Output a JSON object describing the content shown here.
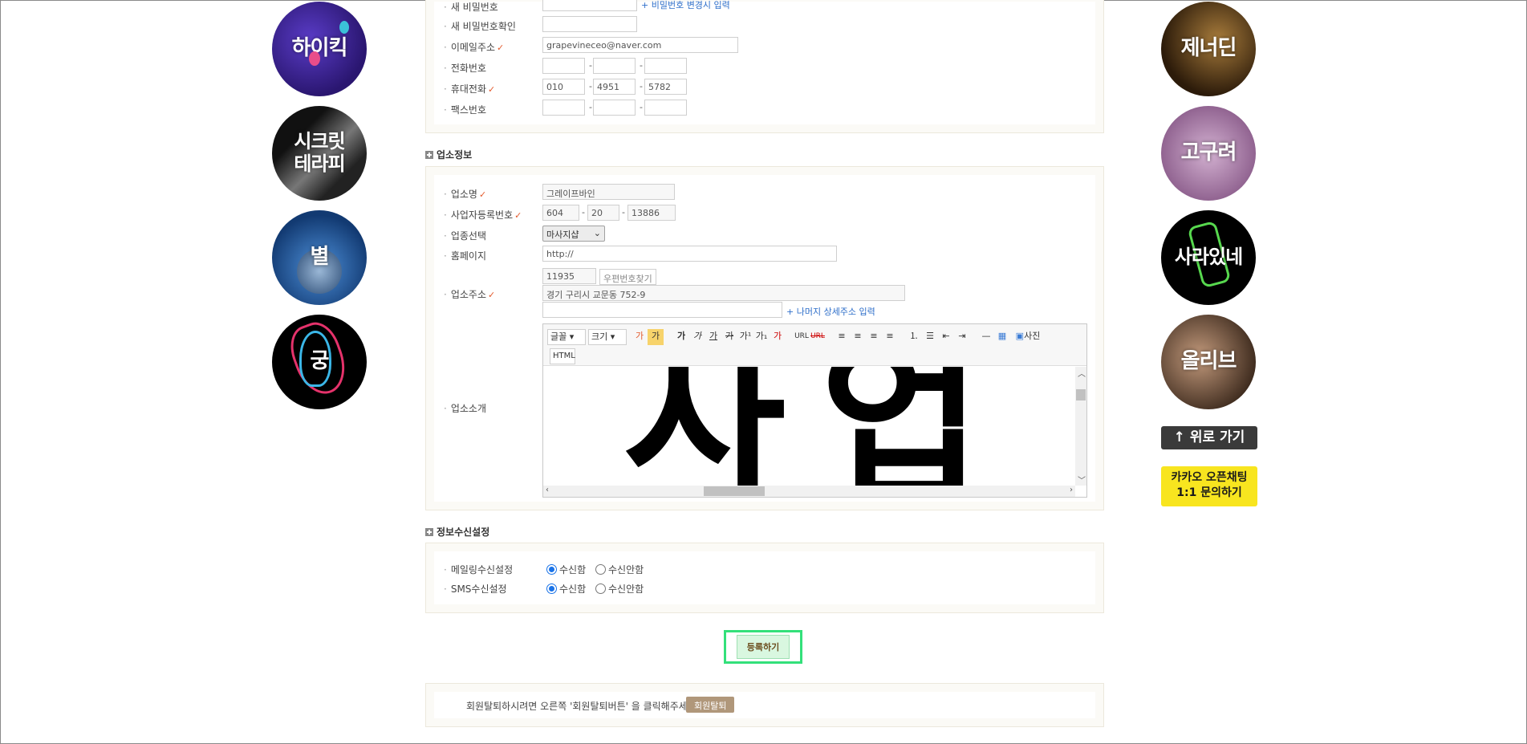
{
  "left_banners": [
    "하이킥",
    "시크릿 테라피",
    "별",
    "궁"
  ],
  "right_banners": [
    "제너딘",
    "고구려",
    "사라있네",
    "올리브"
  ],
  "top_button": "↑ 위로 가기",
  "kakao_button": {
    "line1": "카카오 오픈채팅",
    "line2": "1:1 문의하기"
  },
  "account": {
    "current_password_label": "새 비밀번호",
    "change_password_link": "+ 비밀번호 변경시 입력",
    "confirm_password_label": "새 비밀번호확인",
    "email_label": "이메일주소",
    "email_value": "grapevineceo@naver.com",
    "phone_label": "전화번호",
    "mobile_label": "휴대전화",
    "mobile": [
      "010",
      "4951",
      "5782"
    ],
    "fax_label": "팩스번호"
  },
  "business": {
    "section_title": "업소정보",
    "name_label": "업소명",
    "name_value": "그레이프바인",
    "regno_label": "사업자등록번호",
    "regno": [
      "604",
      "20",
      "13886"
    ],
    "type_label": "업종선택",
    "type_value": "마사지샵",
    "homepage_label": "홈페이지",
    "homepage_value": "http://",
    "address_label": "업소주소",
    "zipcode": "11935",
    "zip_button": "우편번호찾기",
    "address_value": "경기 구리시 교문동 752-9",
    "detail_link": "+ 나머지 상세주소 입력",
    "intro_label": "업소소개",
    "editor": {
      "font": "글꼴",
      "size": "크기",
      "html": "HTML",
      "photo": "사진",
      "url": "URL",
      "content_chars": [
        "사",
        "업"
      ]
    }
  },
  "receive": {
    "section_title": "정보수신설정",
    "mailing_label": "메일링수신설정",
    "sms_label": "SMS수신설정",
    "yes": "수신함",
    "no": "수신안함"
  },
  "submit_label": "등록하기",
  "withdraw": {
    "text": "회원탈퇴하시려면 오른쪽 '회원탈퇴버튼' 을 클릭해주세요.",
    "button": "회원탈퇴"
  }
}
